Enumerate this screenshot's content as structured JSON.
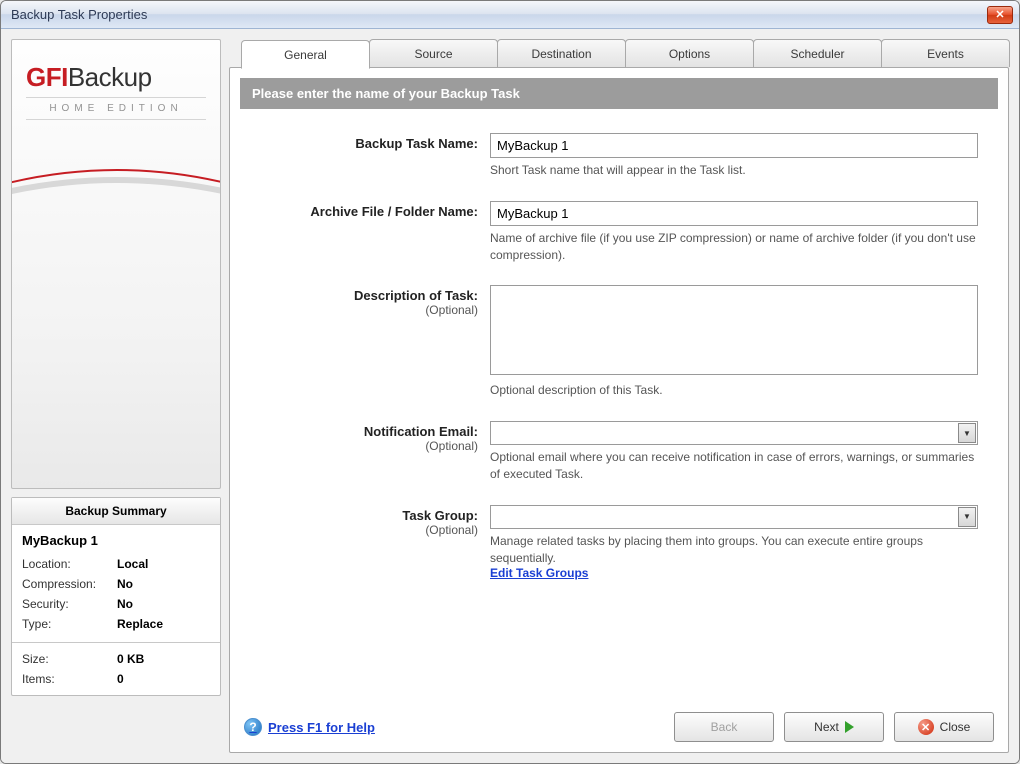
{
  "window": {
    "title": "Backup Task Properties"
  },
  "logo": {
    "brand_pre": "GFI",
    "brand_post": "Backup",
    "edition": "HOME EDITION"
  },
  "tabs": [
    {
      "label": "General"
    },
    {
      "label": "Source"
    },
    {
      "label": "Destination"
    },
    {
      "label": "Options"
    },
    {
      "label": "Scheduler"
    },
    {
      "label": "Events"
    }
  ],
  "banner": "Please enter the name of your Backup Task",
  "form": {
    "name": {
      "label": "Backup Task Name:",
      "value": "MyBackup 1",
      "hint": "Short Task name that will appear in the Task list."
    },
    "archive": {
      "label": "Archive File / Folder Name:",
      "value": "MyBackup 1",
      "hint": "Name of archive file (if you use ZIP compression) or name of archive folder (if you don't use compression)."
    },
    "description": {
      "label": "Description of Task:",
      "optional": "(Optional)",
      "value": "",
      "hint": "Optional description of this Task."
    },
    "email": {
      "label": "Notification Email:",
      "optional": "(Optional)",
      "value": "",
      "hint": "Optional email where you can receive notification in case of errors, warnings, or summaries of executed Task."
    },
    "group": {
      "label": "Task Group:",
      "optional": "(Optional)",
      "value": "",
      "hint": "Manage related tasks by placing them into groups. You can execute entire groups sequentially.",
      "edit_link": "Edit Task Groups"
    }
  },
  "summary": {
    "header": "Backup Summary",
    "task_name": "MyBackup 1",
    "rows": {
      "location_lbl": "Location:",
      "location_val": "Local",
      "compression_lbl": "Compression:",
      "compression_val": "No",
      "security_lbl": "Security:",
      "security_val": "No",
      "type_lbl": "Type:",
      "type_val": "Replace",
      "size_lbl": "Size:",
      "size_val": "0 KB",
      "items_lbl": "Items:",
      "items_val": "0"
    }
  },
  "buttons": {
    "help": "Press F1 for Help",
    "back": "Back",
    "next": "Next",
    "close": "Close"
  }
}
